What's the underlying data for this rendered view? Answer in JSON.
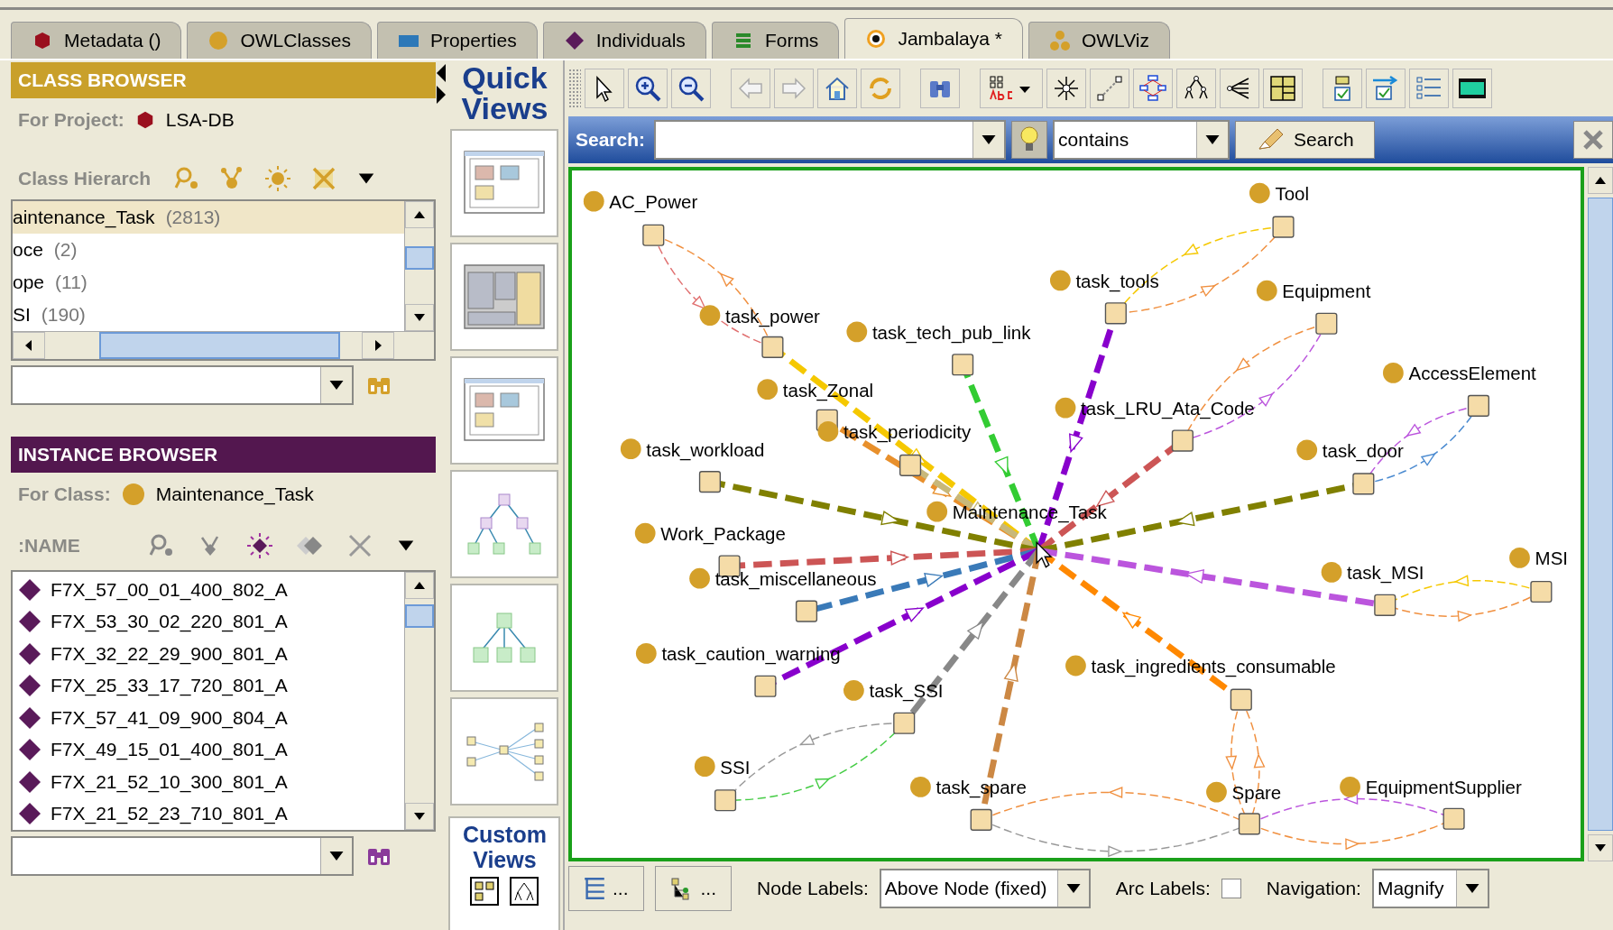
{
  "tabs": [
    {
      "label": "Metadata ()",
      "selected": false
    },
    {
      "label": "OWLClasses",
      "selected": false
    },
    {
      "label": "Properties",
      "selected": false
    },
    {
      "label": "Individuals",
      "selected": false
    },
    {
      "label": "Forms",
      "selected": false
    },
    {
      "label": "Jambalaya *",
      "selected": true
    },
    {
      "label": "OWLViz",
      "selected": false
    }
  ],
  "class_browser": {
    "title": "CLASS BROWSER",
    "project_label": "For Project:",
    "project": "LSA-DB",
    "hierarchy_label": "Class Hierarch",
    "tree": [
      {
        "name": "aintenance_Task",
        "count": "(2813)",
        "selected": true
      },
      {
        "name": "oce",
        "count": "(2)",
        "selected": false
      },
      {
        "name": "ope",
        "count": "(11)",
        "selected": false
      },
      {
        "name": "SI",
        "count": "(190)",
        "selected": false
      }
    ]
  },
  "instance_browser": {
    "title": "INSTANCE BROWSER",
    "class_label": "For Class:",
    "class": "Maintenance_Task",
    "column": ":NAME",
    "instances": [
      "F7X_57_00_01_400_802_A",
      "F7X_53_30_02_220_801_A",
      "F7X_32_22_29_900_801_A",
      "F7X_25_33_17_720_801_A",
      "F7X_57_41_09_900_804_A",
      "F7X_49_15_01_400_801_A",
      "F7X_21_52_10_300_801_A",
      "F7X_21_52_23_710_801_A"
    ]
  },
  "quick_views": {
    "title": "Quick Views",
    "custom_title": "Custom Views"
  },
  "search": {
    "label": "Search:",
    "mode": "contains",
    "button": "Search"
  },
  "graph": {
    "nodes": [
      "AC_Power",
      "Tool",
      "task_tools",
      "Equipment",
      "task_power",
      "task_tech_pub_link",
      "AccessElement",
      "task_Zonal",
      "task_LRU_Ata_Code",
      "task_periodicity",
      "task_workload",
      "task_door",
      "Maintenance_Task",
      "Work_Package",
      "task_miscellaneous",
      "task_MSI",
      "MSI",
      "task_caution_warning",
      "task_SSI",
      "task_ingredients_consumable",
      "SSI",
      "task_spare",
      "Spare",
      "EquipmentSupplier"
    ]
  },
  "bottom_bar": {
    "buttons": [
      "...",
      "..."
    ],
    "node_labels_label": "Node Labels:",
    "node_labels": "Above Node (fixed)",
    "arc_labels_label": "Arc Labels:",
    "arc_labels_checked": false,
    "navigation_label": "Navigation:",
    "navigation": "Magnify"
  }
}
